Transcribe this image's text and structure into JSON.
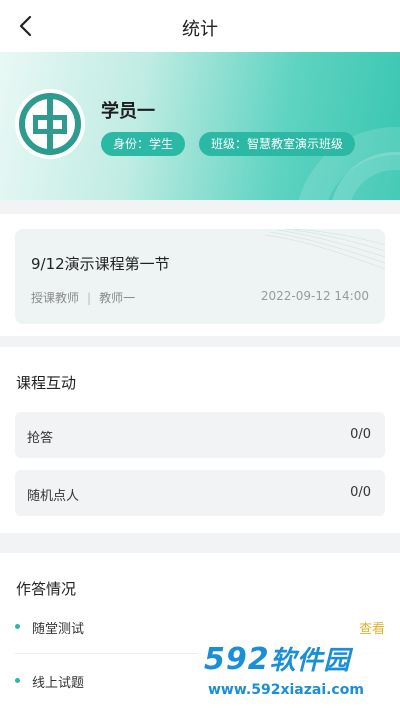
{
  "navbar": {
    "title": "统计",
    "back_icon": "chevron-left-icon"
  },
  "profile": {
    "name": "学员一",
    "role_tag": "身份：学生",
    "class_tag": "班级：智慧教室演示班级",
    "avatar_icon": "bank-logo-icon"
  },
  "lesson": {
    "title": "9/12演示课程第一节",
    "teacher_label": "授课教师",
    "teacher_name": "教师一",
    "datetime": "2022-09-12 14:00"
  },
  "interaction": {
    "heading": "课程互动",
    "rows": [
      {
        "label": "抢答",
        "value": "0/0"
      },
      {
        "label": "随机点人",
        "value": "0/0"
      }
    ]
  },
  "answers": {
    "heading": "作答情况",
    "items": [
      {
        "label": "随堂测试",
        "action": "查看"
      },
      {
        "label": "线上试题"
      }
    ]
  },
  "watermark": {
    "logo": "592",
    "logo_cn": "软件园",
    "url": "www.592xiazai.com"
  },
  "colors": {
    "accent": "#2bb8a4",
    "link": "#e2b12a",
    "background": "#f2f3f5"
  }
}
